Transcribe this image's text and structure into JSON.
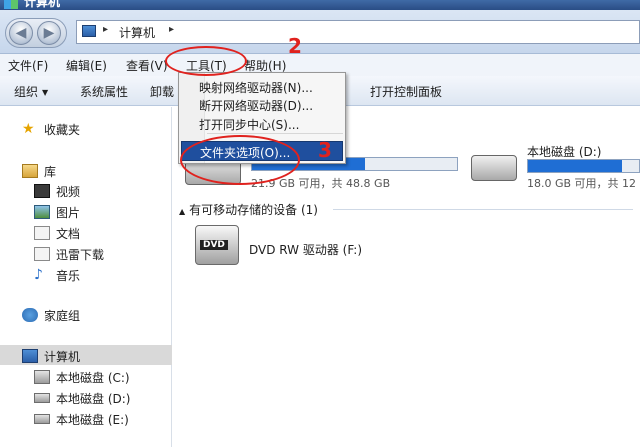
{
  "window": {
    "title": "计算机"
  },
  "address": {
    "crumb": "计算机"
  },
  "menubar": [
    {
      "label": "文件(F)"
    },
    {
      "label": "编辑(E)"
    },
    {
      "label": "查看(V)"
    },
    {
      "label": "工具(T)"
    },
    {
      "label": "帮助(H)"
    }
  ],
  "toolbar": {
    "organize": "组织",
    "system_props": "系统属性",
    "uninstall": "卸载",
    "control_panel": "打开控制面板"
  },
  "tools_menu": {
    "items": [
      {
        "label": "映射网络驱动器(N)..."
      },
      {
        "label": "断开网络驱动器(D)..."
      },
      {
        "label": "打开同步中心(S)..."
      }
    ],
    "highlighted": "文件夹选项(O)..."
  },
  "sidebar": {
    "favorites": "收藏夹",
    "libraries": "库",
    "lib_items": [
      "视频",
      "图片",
      "文档",
      "迅雷下载",
      "音乐"
    ],
    "homegroup": "家庭组",
    "computer": "计算机",
    "drives": [
      "本地磁盘 (C:)",
      "本地磁盘 (D:)",
      "本地磁盘 (E:)"
    ]
  },
  "content": {
    "drive_c_stats": "21.9 GB 可用，共 48.8 GB",
    "drive_c_used_fraction": 0.55,
    "drive_d_name": "本地磁盘 (D:)",
    "drive_d_stats": "18.0 GB 可用，共 12",
    "drive_d_used_fraction": 0.85,
    "removable_header": "有可移动存储的设备 (1)",
    "dvd_label": "DVD RW 驱动器 (F:)",
    "dvd_icon_text": "DVD"
  },
  "annotations": {
    "step2": "2",
    "step3": "3"
  },
  "colors": {
    "annotation": "#e0221e",
    "highlight": "#1f4f9e",
    "bar_fill": "#1f6ed4"
  }
}
